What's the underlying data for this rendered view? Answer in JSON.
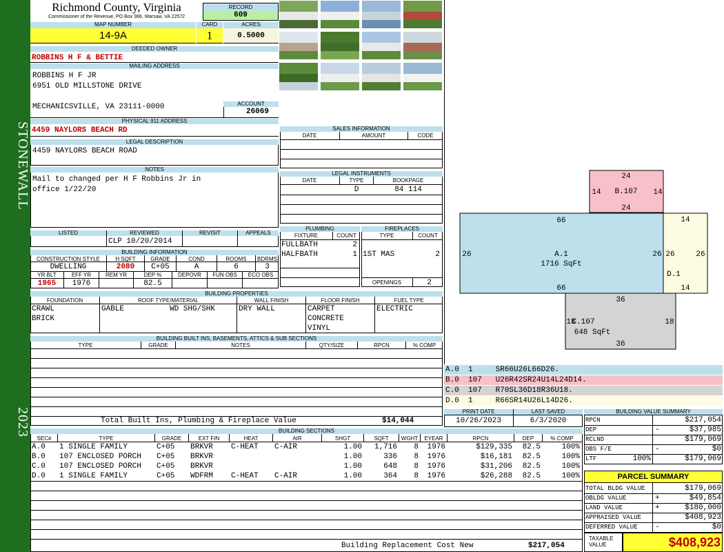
{
  "county": {
    "name": "Richmond County, Virginia",
    "address": "Commissioner of the Revenue, PO Box 366, Warsaw, VA 22572"
  },
  "sidebar": {
    "district": "STONEWALL",
    "year": "2023"
  },
  "record": {
    "label": "RECORD",
    "value": "609"
  },
  "map": {
    "map_label": "MAP NUMBER",
    "map_value": "14-9A",
    "card_label": "CARD",
    "card_value": "1",
    "acres_label": "ACRES",
    "acres_value": "0.5000"
  },
  "owner": {
    "label": "DEEDED OWNER",
    "value": "ROBBINS H F & BETTIE"
  },
  "mailing": {
    "label": "MAILING ADDRESS",
    "line1": "ROBBINS H F JR",
    "line2": "6951 OLD MILLSTONE DRIVE",
    "line3": "MECHANICSVILLE, VA 23111-0000"
  },
  "account": {
    "label": "ACCOUNT",
    "value": "26069"
  },
  "physical": {
    "label": "PHYSICAL 911 ADDRESS",
    "value": "4459 NAYLORS BEACH RD"
  },
  "legal": {
    "label": "LEGAL DESCRIPTION",
    "value": "4459 NAYLORS BEACH ROAD"
  },
  "notes": {
    "label": "NOTES",
    "line1": "Mail to changed per H F Robbins Jr in",
    "line2": "office 1/22/20"
  },
  "review": {
    "listed_label": "LISTED",
    "reviewed_label": "REVIEWED",
    "revisit_label": "REVISIT",
    "appeals_label": "APPEALS",
    "reviewed_value": "CLP 10/20/2014"
  },
  "building_info": {
    "label": "BUILDING INFORMATION",
    "h1": [
      "CONSTRUCTION STYLE",
      "H SQFT",
      "GRADE",
      "COND",
      "ROOMS",
      "BDRMS"
    ],
    "v1": [
      "DWELLING",
      "2080",
      "C+05",
      "A",
      "6",
      "3"
    ],
    "h2": [
      "YR BLT",
      "EFF YR",
      "REM YR",
      "DEP %",
      "DEPOVR",
      "FUN OBS",
      "ECO OBS"
    ],
    "v2": [
      "1965",
      "1976",
      "",
      "82.5",
      "",
      "",
      ""
    ]
  },
  "sales": {
    "label": "SALES INFORMATION",
    "cols": [
      "DATE",
      "AMOUNT",
      "CODE"
    ]
  },
  "instruments": {
    "label": "LEGAL INSTRUMENTS",
    "cols": [
      "DATE",
      "TYPE",
      "BOOKPAGE"
    ],
    "row": [
      "",
      "D",
      "84 114"
    ]
  },
  "plumbing": {
    "label": "PLUMBING",
    "cols": [
      "FIXTURE",
      "COUNT"
    ],
    "rows": [
      [
        "FULLBATH",
        "2"
      ],
      [
        "HALFBATH",
        "1"
      ]
    ]
  },
  "fireplaces": {
    "label": "FIREPLACES",
    "cols": [
      "TYPE",
      "COUNT"
    ],
    "rows": [
      [
        "1ST MAS",
        "2"
      ]
    ],
    "openings_label": "OPENINGS",
    "openings_value": "2"
  },
  "properties": {
    "label": "BUILDING PROPERTIES",
    "cols": [
      "FOUNDATION",
      "ROOF TYPE/MATERIAL",
      "WALL FINISH",
      "FLOOR FINISH",
      "FUEL TYPE"
    ],
    "foundation": [
      "CRAWL",
      "BRICK"
    ],
    "roof_type": "GABLE",
    "roof_material": "WD SHG/SHK",
    "wall": "DRY WALL",
    "floor": [
      "CARPET",
      "CONCRETE",
      "VINYL"
    ],
    "fuel": "ELECTRIC"
  },
  "builtins": {
    "label": "BUILDING BUILT INS, BASEMENTS, ATTICS & SUB SECTIONS",
    "cols": [
      "TYPE",
      "GRADE",
      "NOTES",
      "QTY/SIZE",
      "RPCN",
      "% COMP"
    ],
    "total_label": "Total Built Ins, Plumbing & Fireplace Value",
    "total_value": "$14,044"
  },
  "sections": {
    "label": "BUILDING SECTIONS",
    "cols": [
      "SEC#",
      "TYPE",
      "GRADE",
      "EXT FIN",
      "HEAT",
      "AIR",
      "SHGT",
      "SQFT",
      "WGHT",
      "EYEAR",
      "RPCN",
      "DEP",
      "% COMP"
    ],
    "rows": [
      [
        "A.0",
        "1 SINGLE FAMILY",
        "C+05",
        "BRKVR",
        "C-HEAT",
        "C-AIR",
        "1.00",
        "1,716",
        "8",
        "1976",
        "$129,335",
        "82.5",
        "100%"
      ],
      [
        "B.0",
        "107 ENCLOSED PORCH",
        "C+05",
        "BRKVR",
        "",
        "",
        "1.00",
        "336",
        "8",
        "1976",
        "$16,181",
        "82.5",
        "100%"
      ],
      [
        "C.0",
        "107 ENCLOSED PORCH",
        "C+05",
        "BRKVR",
        "",
        "",
        "1.00",
        "648",
        "8",
        "1976",
        "$31,206",
        "82.5",
        "100%"
      ],
      [
        "D.0",
        "1 SINGLE FAMILY",
        "C+05",
        "WDFRM",
        "C-HEAT",
        "C-AIR",
        "1.00",
        "364",
        "8",
        "1976",
        "$26,288",
        "82.5",
        "100%"
      ]
    ],
    "replacement_label": "Building Replacement Cost New",
    "replacement_value": "$217,054"
  },
  "sketch": {
    "b_label": "B.107",
    "b_top": "24",
    "b_bottom": "24",
    "b_left": "14",
    "b_right": "14",
    "a_label": "A.1",
    "a_sqft": "1716 SqFt",
    "a_top": "66",
    "a_bottom": "66",
    "a_left": "26",
    "a_right": "26",
    "d_label": "D.1",
    "d_top": "14",
    "d_bottom": "14",
    "d_left": "26",
    "d_right": "26",
    "c_label": "C.107",
    "c_sqft": "648 SqFt",
    "c_top": "36",
    "c_bottom": "36",
    "c_left": "18",
    "c_right": "18"
  },
  "segments": [
    {
      "text": "A.0  1     SR66U26L66D26.",
      "color": "#bde0ec"
    },
    {
      "text": "B.0  107   U26R42SR24U14L24D14.",
      "color": "#f8c0c8"
    },
    {
      "text": "C.0  107   R70SL36D18R36U18.",
      "color": "#d4d4d4"
    },
    {
      "text": "D.0  1     R66SR14U26L14D26.",
      "color": "#fdfbe2"
    }
  ],
  "dates": {
    "print_label": "PRINT DATE",
    "print_value": "10/26/2023",
    "saved_label": "LAST SAVED",
    "saved_value": "6/3/2020"
  },
  "bvs": {
    "label": "BUILDING VALUE SUMMARY",
    "rows": [
      {
        "k": "RPCN",
        "op": "",
        "v": "$217,054"
      },
      {
        "k": "DEP",
        "op": "-",
        "v": "$37,985"
      },
      {
        "k": "RCLND",
        "op": "",
        "v": "$179,069"
      },
      {
        "k": "OBS F/E",
        "op": "-",
        "v": "$0"
      },
      {
        "k": "LTF",
        "pct": "100%",
        "op": "",
        "v": "$179,069"
      }
    ]
  },
  "parcel": {
    "label": "PARCEL SUMMARY",
    "rows": [
      {
        "k": "TOTAL BLDG VALUE",
        "op": "",
        "v": "$179,069"
      },
      {
        "k": "OBLDG VALUE",
        "op": "+",
        "v": "$49,854"
      },
      {
        "k": "LAND VALUE",
        "op": "+",
        "v": "$180,000"
      },
      {
        "k": "APPRAISED VALUE",
        "op": "",
        "v": "$408,923"
      },
      {
        "k": "DEFERRED VALUE",
        "op": "-",
        "v": "$0"
      }
    ],
    "taxable_label1": "TAXABLE",
    "taxable_label2": "VALUE",
    "taxable_value": "$408,923"
  },
  "colors": {
    "sidebar": "#1f6e1f",
    "header": "#bde0ec",
    "yellow": "#ffff33",
    "green": "#b8f0a0",
    "accent_red": "#c00000"
  }
}
